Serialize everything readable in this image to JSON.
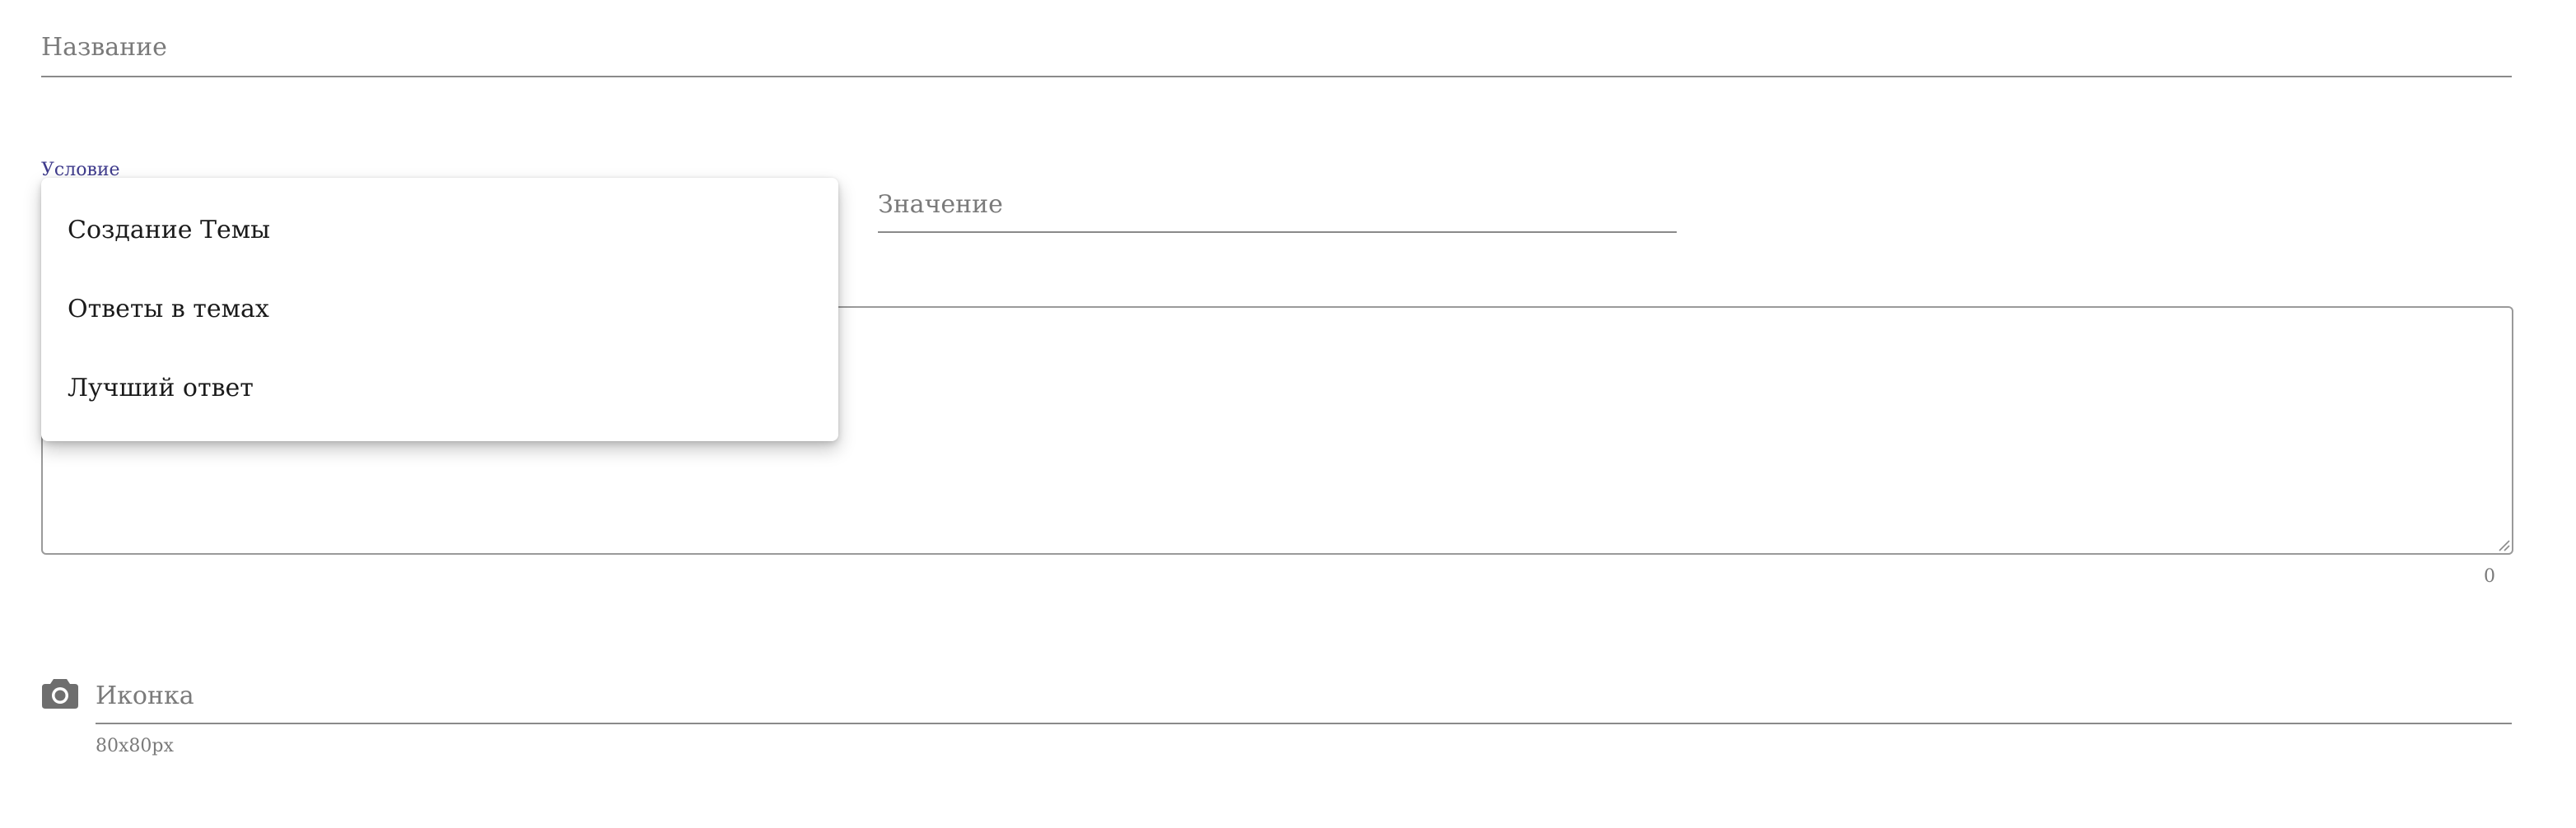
{
  "form": {
    "title_field": {
      "placeholder": "Название"
    },
    "condition_field": {
      "label": "Условие",
      "options": [
        "Создание Темы",
        "Ответы в темах",
        "Лучший ответ"
      ]
    },
    "value_field": {
      "placeholder": "Значение"
    },
    "textarea": {
      "value": "",
      "counter": "0"
    },
    "icon_field": {
      "icon": "camera-icon",
      "placeholder": "Иконка",
      "hint": "80x80px"
    }
  },
  "colors": {
    "accent": "#3f3b8c",
    "placeholder": "#7a7a7a",
    "underline": "#8a8a8a",
    "text": "#1a1a1a"
  }
}
